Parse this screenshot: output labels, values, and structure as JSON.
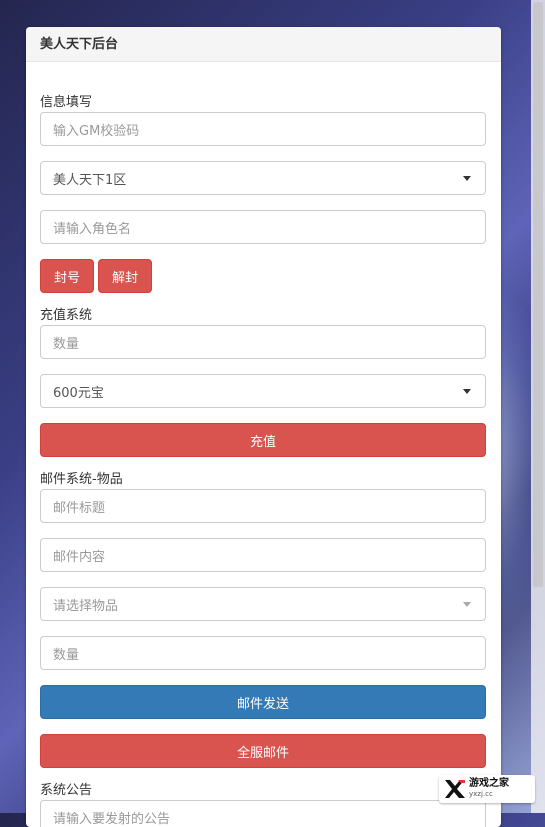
{
  "panel": {
    "title": "美人天下后台"
  },
  "info_section": {
    "label": "信息填写",
    "gm_code_placeholder": "输入GM校验码",
    "server_selected": "美人天下1区",
    "role_placeholder": "请输入角色名",
    "ban_button": "封号",
    "unban_button": "解封"
  },
  "recharge_section": {
    "label": "充值系统",
    "amount_placeholder": "数量",
    "package_selected": "600元宝",
    "recharge_button": "充值"
  },
  "mail_section": {
    "label": "邮件系统-物品",
    "title_placeholder": "邮件标题",
    "content_placeholder": "邮件内容",
    "item_placeholder": "请选择物品",
    "amount_placeholder": "数量",
    "send_button": "邮件发送",
    "all_server_button": "全服邮件"
  },
  "notice_section": {
    "label": "系统公告",
    "notice_placeholder": "请输入要发射的公告"
  },
  "watermark": {
    "name": "游戏之家",
    "url": "yxzj.cc"
  },
  "colors": {
    "danger": "#d9534f",
    "primary": "#337ab7"
  }
}
